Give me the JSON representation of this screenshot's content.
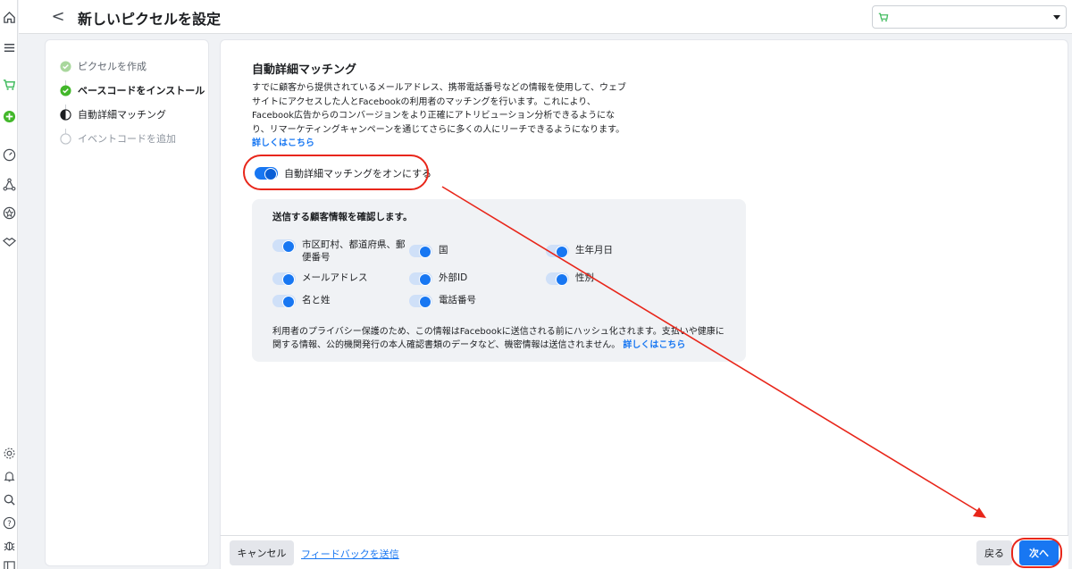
{
  "header": {
    "back_label": "<",
    "title": "新しいピクセルを設定",
    "account_select": ""
  },
  "steps": [
    {
      "label": "ピクセルを作成",
      "state": "done"
    },
    {
      "label": "ベースコードをインストール",
      "state": "current-done"
    },
    {
      "label": "自動詳細マッチング",
      "state": "in-progress"
    },
    {
      "label": "イベントコードを追加",
      "state": "pending"
    }
  ],
  "section": {
    "title": "自動詳細マッチング",
    "description": "すでに顧客から提供されているメールアドレス、携帯電話番号などの情報を使用して、ウェブサイトにアクセスした人とFacebookの利用者のマッチングを行います。これにより、Facebook広告からのコンバージョンをより正確にアトリビューション分析できるようになり、リマーケティングキャンペーンを通じてさらに多くの人にリーチできるようになります。",
    "learn_more": "詳しくはこちら",
    "main_toggle_label": "自動詳細マッチングをオンにする"
  },
  "customer_info": {
    "title": "送信する顧客情報を確認します。",
    "items": [
      {
        "label": "市区町村、都道府県、郵便番号"
      },
      {
        "label": "国"
      },
      {
        "label": "生年月日"
      },
      {
        "label": "メールアドレス"
      },
      {
        "label": "外部ID"
      },
      {
        "label": "性別"
      },
      {
        "label": "名と姓"
      },
      {
        "label": "電話番号"
      }
    ],
    "note": "利用者のプライバシー保護のため、この情報はFacebookに送信される前にハッシュ化されます。支払いや健康に関する情報、公的機関発行の本人確認書類のデータなど、機密情報は送信されません。",
    "note_link": "詳しくはこちら"
  },
  "footer": {
    "cancel": "キャンセル",
    "feedback": "フィードバックを送信",
    "back": "戻る",
    "next": "次へ"
  },
  "colors": {
    "accent": "#1877f2",
    "success": "#42b72a",
    "annotation": "#e8261a"
  }
}
